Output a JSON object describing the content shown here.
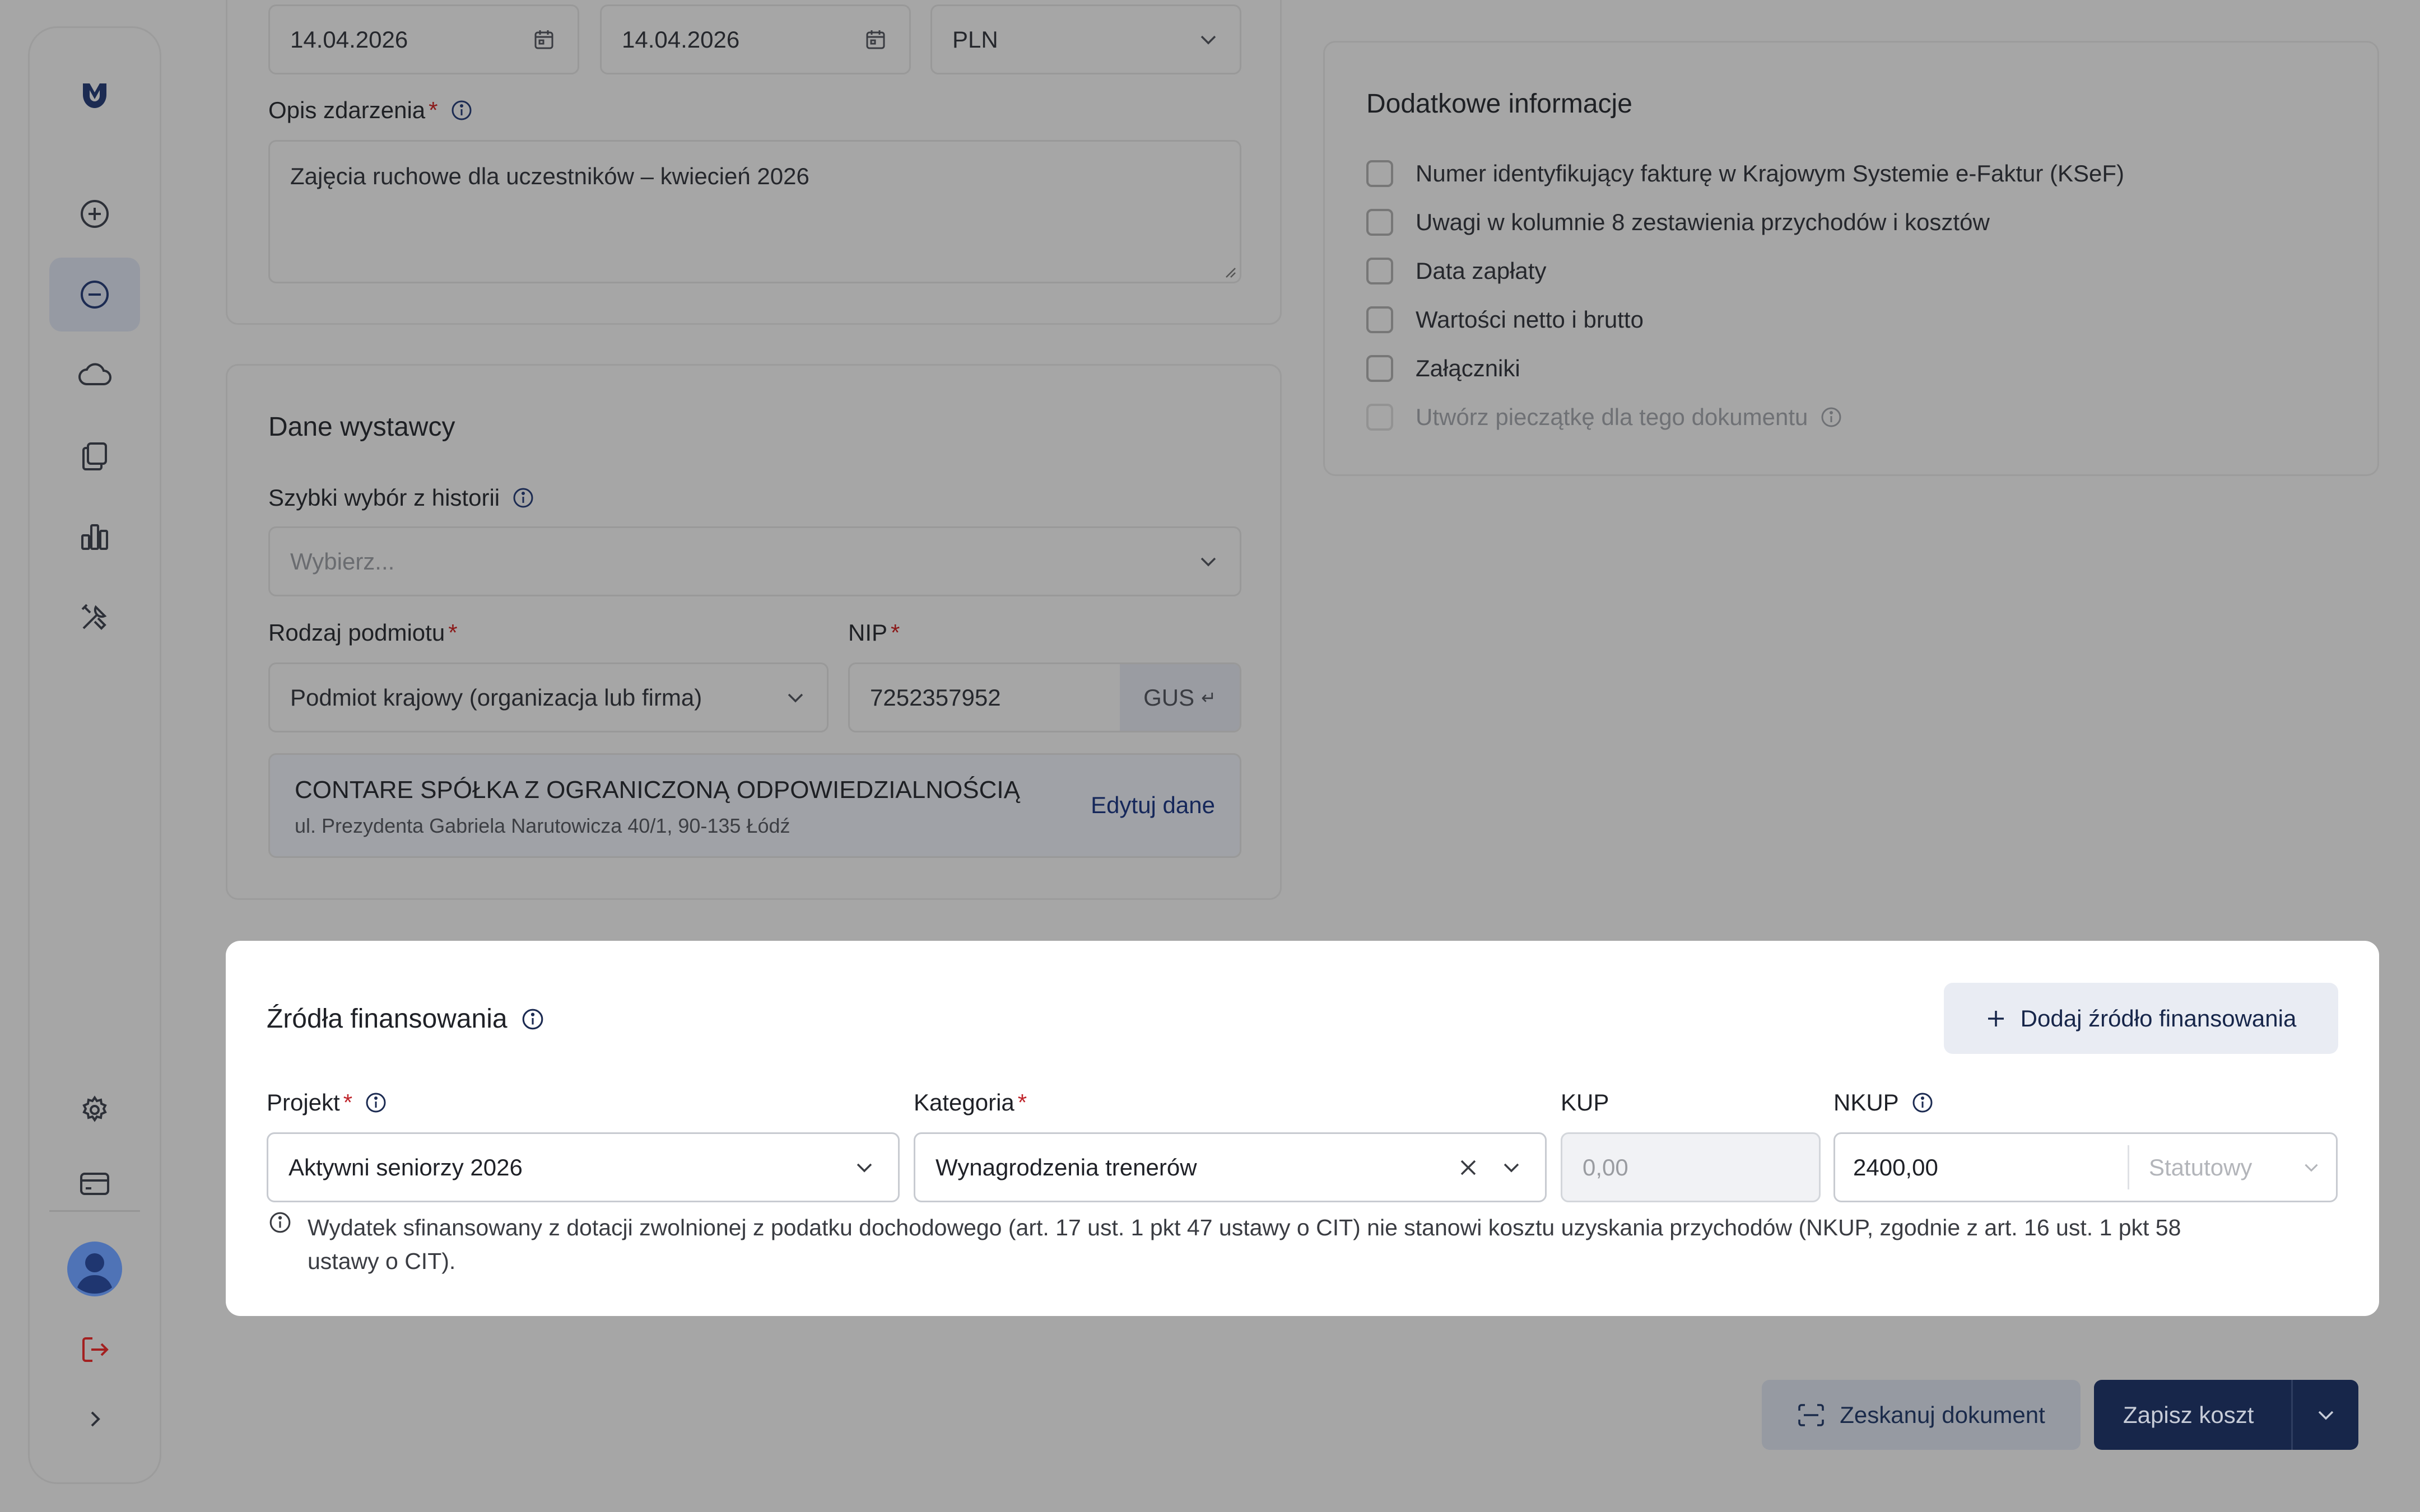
{
  "colors": {
    "backdrop": "#a6a6a6",
    "primary": "#17264a",
    "required": "#c0262d",
    "white_panel": "#ffffff"
  },
  "sidebar": {
    "items": [
      {
        "name": "logo-icon"
      },
      {
        "name": "plus-circle-icon"
      },
      {
        "name": "minus-circle-icon",
        "active": true
      },
      {
        "name": "cloud-icon"
      },
      {
        "name": "files-icon"
      },
      {
        "name": "bar-chart-icon"
      },
      {
        "name": "tools-icon"
      },
      {
        "name": "gear-icon"
      },
      {
        "name": "card-icon"
      },
      {
        "name": "avatar"
      },
      {
        "name": "logout-icon"
      },
      {
        "name": "chevron-right-icon"
      }
    ]
  },
  "event": {
    "date_1": "14.04.2026",
    "date_2": "14.04.2026",
    "currency": "PLN",
    "description_label": "Opis zdarzenia",
    "description_value": "Zajęcia ruchowe dla uczestników – kwiecień 2026"
  },
  "issuer": {
    "title": "Dane wystawcy",
    "history_label": "Szybki wybór z historii",
    "history_placeholder": "Wybierz...",
    "entity_type_label": "Rodzaj podmiotu",
    "entity_type_value": "Podmiot krajowy (organizacja lub firma)",
    "nip_label": "NIP",
    "nip_value": "7252357952",
    "gus_label": "GUS",
    "company_name": "CONTARE SPÓŁKA Z OGRANICZONĄ ODPOWIEDZIALNOŚCIĄ",
    "company_address": "ul. Prezydenta Gabriela Narutowicza 40/1, 90-135 Łódź",
    "edit_label": "Edytuj dane"
  },
  "extra": {
    "title": "Dodatkowe informacje",
    "options": [
      {
        "label": "Numer identyfikujący fakturę w Krajowym Systemie e-Faktur (KSeF)"
      },
      {
        "label": "Uwagi w kolumnie 8 zestawienia przychodów i kosztów"
      },
      {
        "label": "Data zapłaty"
      },
      {
        "label": "Wartości netto i brutto"
      },
      {
        "label": "Załączniki"
      },
      {
        "label": "Utwórz pieczątkę dla tego dokumentu"
      }
    ]
  },
  "funding": {
    "title": "Źródła finansowania",
    "add_button": "Dodaj źródło finansowania",
    "project_label": "Projekt",
    "project_value": "Aktywni seniorzy 2026",
    "category_label": "Kategoria",
    "category_value": "Wynagrodzenia trenerów",
    "kup_label": "KUP",
    "kup_placeholder": "0,00",
    "nkup_label": "NKUP",
    "nkup_value": "2400,00",
    "nkup_type_placeholder": "Statutowy",
    "note_line1": "Wydatek sfinansowany z dotacji zwolnionej z podatku dochodowego (art. 17 ust. 1 pkt 47 ustawy o CIT) nie stanowi kosztu uzyskania przychodów (NKUP, zgodnie z art. 16 ust. 1 pkt 58",
    "note_line2": "ustawy o CIT)."
  },
  "actions": {
    "scan_label": "Zeskanuj dokument",
    "save_label": "Zapisz koszt"
  }
}
